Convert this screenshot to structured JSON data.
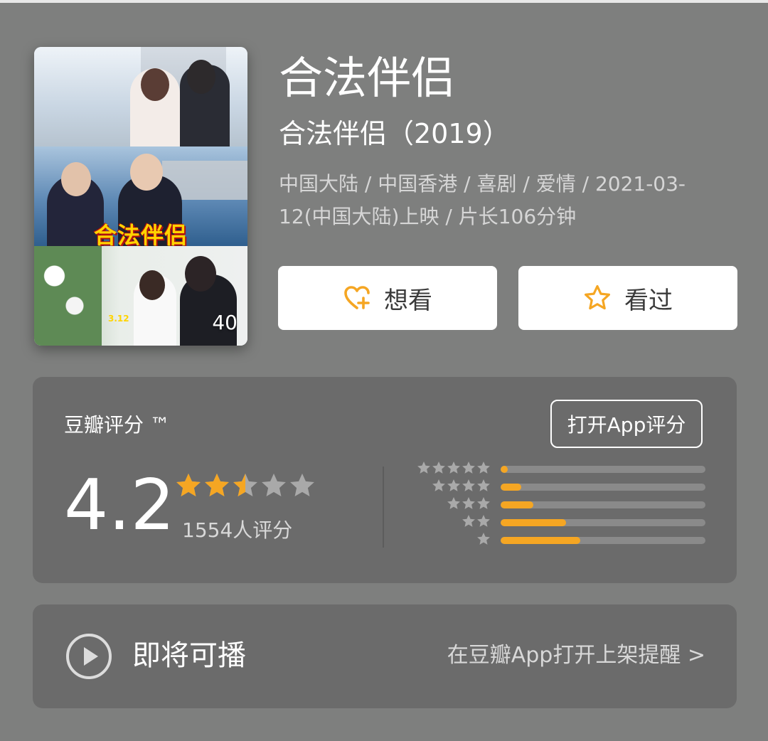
{
  "movie": {
    "title": "合法伴侣",
    "original_title": "合法伴侣（2019）",
    "meta": "中国大陆 / 中国香港 / 喜剧 / 爱情 / 2021-03-12(中国大陆)上映 / 片长106分钟",
    "poster": {
      "logo_text": "合法伴侣",
      "date_text": "3.12",
      "badge": "40"
    }
  },
  "actions": {
    "want_label": "想看",
    "want_icon": "heart-plus-icon",
    "seen_label": "看过",
    "seen_icon": "star-outline-icon",
    "accent_color": "#f5a623"
  },
  "rating": {
    "brand": "豆瓣评分 ™",
    "open_app_label": "打开App评分",
    "score": "4.2",
    "votes": "1554人评分",
    "star_value": 2.5,
    "distribution": [
      {
        "stars": 5,
        "fraction": 0.03
      },
      {
        "stars": 4,
        "fraction": 0.1
      },
      {
        "stars": 3,
        "fraction": 0.16
      },
      {
        "stars": 2,
        "fraction": 0.32
      },
      {
        "stars": 1,
        "fraction": 0.39
      }
    ]
  },
  "play": {
    "icon": "play-circle-icon",
    "label": "即将可播",
    "link": "在豆瓣App打开上架提醒 >"
  }
}
